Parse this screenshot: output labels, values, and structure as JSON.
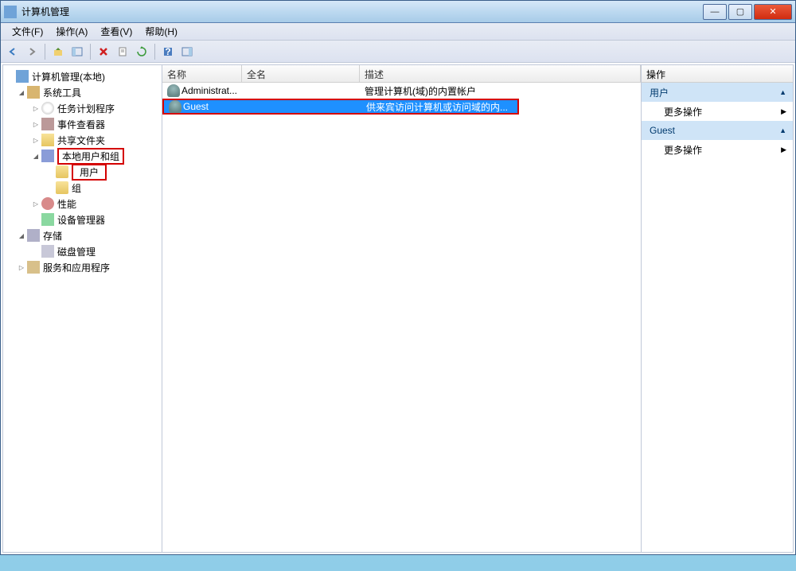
{
  "titlebar": {
    "title": "计算机管理"
  },
  "menu": {
    "file": "文件(F)",
    "action": "操作(A)",
    "view": "查看(V)",
    "help": "帮助(H)"
  },
  "tree": {
    "root": "计算机管理(本地)",
    "system_tools": "系统工具",
    "task_scheduler": "任务计划程序",
    "event_viewer": "事件查看器",
    "shared_folders": "共享文件夹",
    "local_users_groups": "本地用户和组",
    "users": "用户",
    "groups": "组",
    "performance": "性能",
    "device_manager": "设备管理器",
    "storage": "存储",
    "disk_management": "磁盘管理",
    "services_apps": "服务和应用程序"
  },
  "columns": {
    "name": "名称",
    "fullname": "全名",
    "description": "描述"
  },
  "rows": [
    {
      "name": "Administrat...",
      "fullname": "",
      "description": "管理计算机(域)的内置帐户"
    },
    {
      "name": "Guest",
      "fullname": "",
      "description": "供来宾访问计算机或访问域的内..."
    }
  ],
  "actions": {
    "header": "操作",
    "group1": "用户",
    "more1": "更多操作",
    "group2": "Guest",
    "more2": "更多操作"
  },
  "win": {
    "min": "—",
    "max": "▢",
    "close": "✕"
  }
}
